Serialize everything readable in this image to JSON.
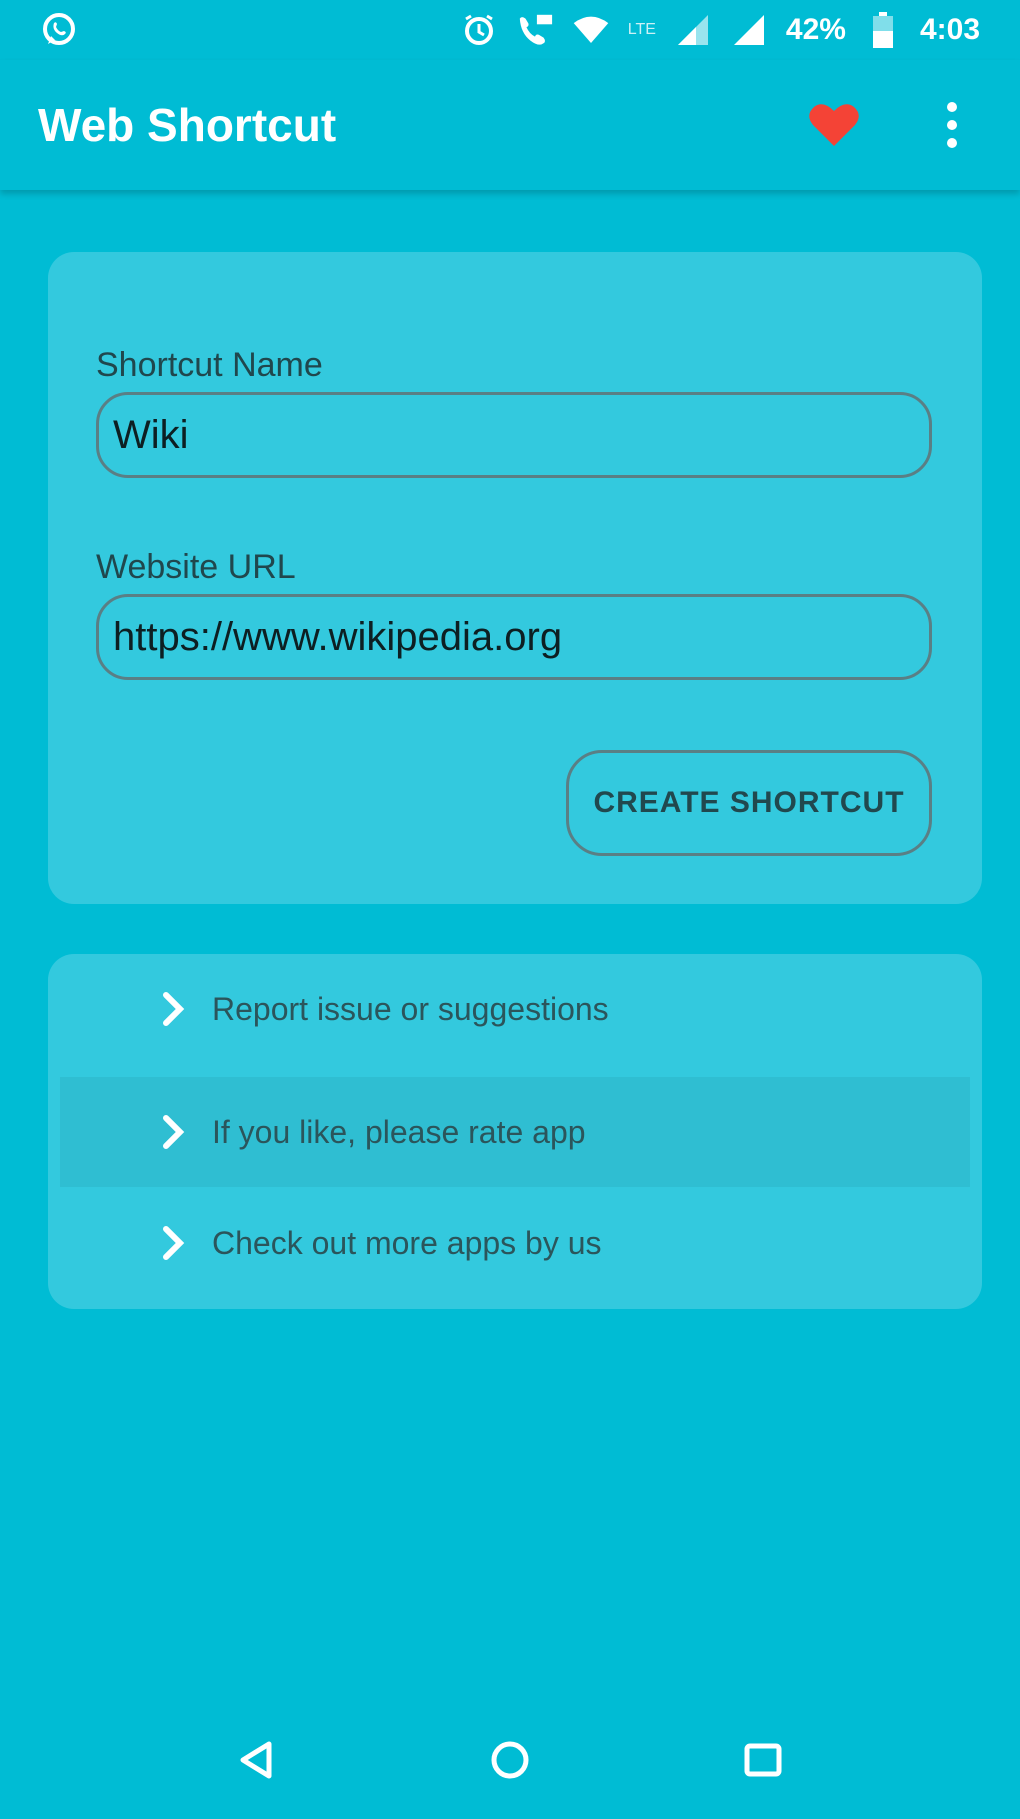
{
  "status_bar": {
    "left_icon": "whatsapp-icon",
    "icons": [
      "alarm-icon",
      "hd-call-icon",
      "wifi-icon",
      "signal-icon",
      "signal-icon",
      "battery-icon"
    ],
    "network_label": "LTE",
    "battery": "42%",
    "time": "4:03"
  },
  "app_bar": {
    "title": "Web Shortcut",
    "actions": [
      "heart-icon",
      "more-vert-icon"
    ],
    "heart_color": "#f44336"
  },
  "form": {
    "name_label": "Shortcut Name",
    "name_value": "Wiki",
    "url_label": "Website URL",
    "url_value": "https://www.wikipedia.org",
    "create_label": "CREATE SHORTCUT"
  },
  "links": [
    {
      "label": "Report issue or suggestions",
      "icon": "chevron-right-icon"
    },
    {
      "label": "If you like, please rate app",
      "icon": "chevron-right-icon"
    },
    {
      "label": "Check out more apps by us",
      "icon": "chevron-right-icon"
    }
  ],
  "nav_bar": [
    "back-icon",
    "home-icon",
    "recents-icon"
  ],
  "colors": {
    "background": "#00bcd4",
    "card": "#33c9de",
    "accent_heart": "#f44336"
  }
}
